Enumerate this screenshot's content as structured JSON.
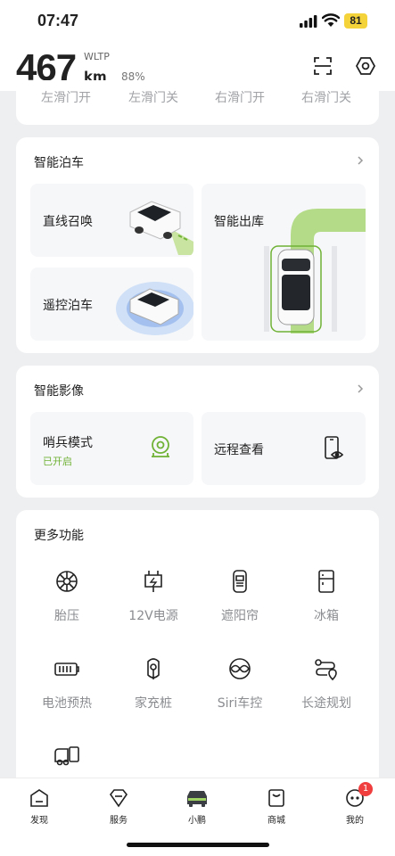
{
  "status_bar": {
    "time": "07:47",
    "battery": "81"
  },
  "header": {
    "range": "467",
    "standard": "WLTP",
    "unit": "km",
    "battery_pct": "88%",
    "scan_icon": "scan-icon",
    "settings_icon": "hexagon-settings-icon"
  },
  "doors": [
    "左滑门开",
    "左滑门关",
    "右滑门开",
    "右滑门关"
  ],
  "parking": {
    "title": "智能泊车",
    "straight_summon": "直线召唤",
    "remote_parking": "遥控泊车",
    "smart_exit": "智能出库"
  },
  "imaging": {
    "title": "智能影像",
    "sentry_mode": "哨兵模式",
    "sentry_status": "已开启",
    "remote_view": "远程查看"
  },
  "more": {
    "title": "更多功能",
    "items": [
      "胎压",
      "12V电源",
      "遮阳帘",
      "冰箱",
      "电池预热",
      "家充桩",
      "Siri车控",
      "长途规划"
    ]
  },
  "tabs": [
    "发现",
    "服务",
    "小鹏",
    "商城",
    "我的"
  ],
  "notification_count": "1",
  "colors": {
    "accent_green": "#6fb235",
    "badge_red": "#f03e3e"
  }
}
